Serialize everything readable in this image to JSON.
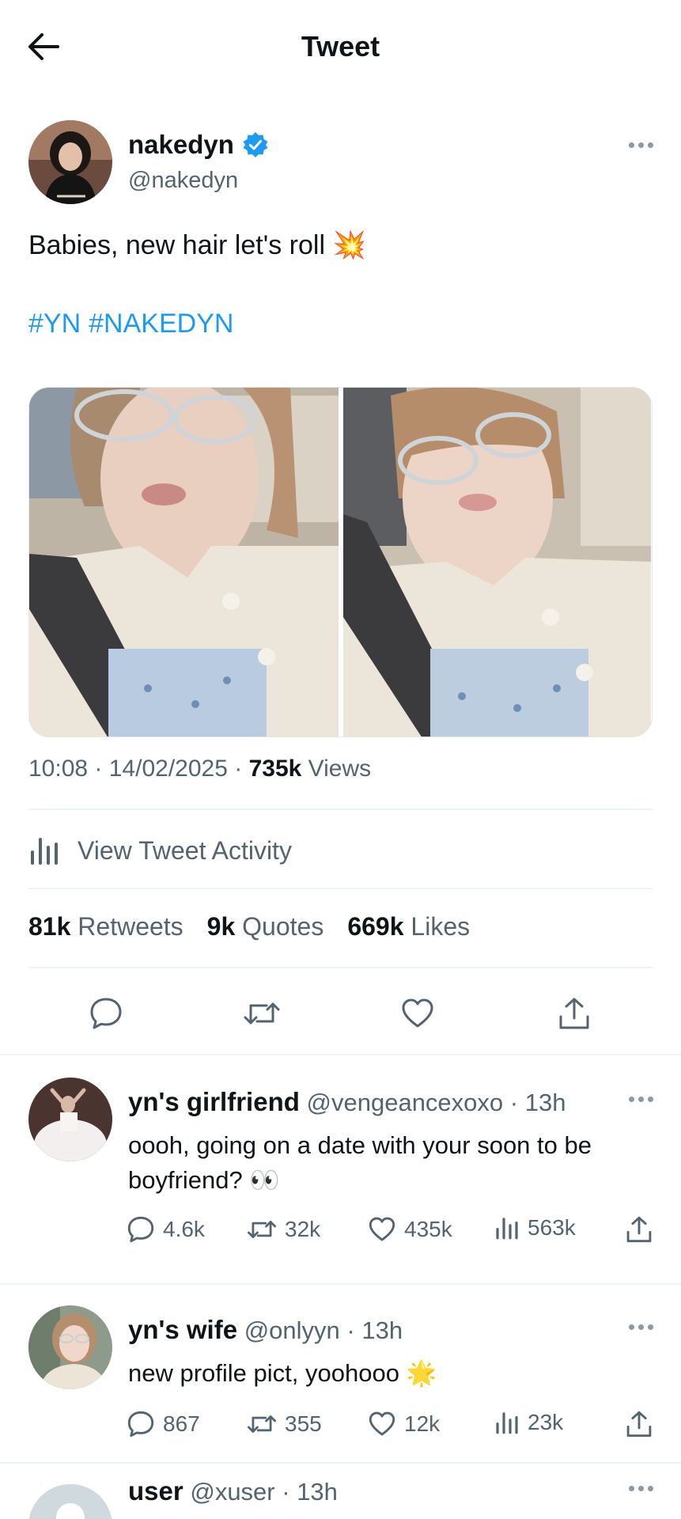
{
  "header": {
    "title": "Tweet",
    "back_icon": "arrow-left-icon"
  },
  "tweet": {
    "author_name": "nakedyn",
    "author_handle": "@nakedyn",
    "verified": true,
    "text": "Babies, new hair let's roll 💥",
    "hashtags": [
      "#YN",
      "#NAKEDYN"
    ],
    "time": "10:08",
    "date": "14/02/2025",
    "views_count": "735k",
    "views_label": "Views",
    "activity_label": "View Tweet Activity",
    "stats": {
      "retweets_count": "81k",
      "retweets_label": "Retweets",
      "quotes_count": "9k",
      "quotes_label": "Quotes",
      "likes_count": "669k",
      "likes_label": "Likes"
    }
  },
  "replies": [
    {
      "name": "yn's girlfriend",
      "handle": "@vengeancexoxo",
      "time": "13h",
      "text": "oooh, going on a date with your soon to be boyfriend? 👀",
      "replies": "4.6k",
      "retweets": "32k",
      "likes": "435k",
      "views": "563k"
    },
    {
      "name": "yn's wife",
      "handle": "@onlyyn",
      "time": "13h",
      "text": "new profile pict, yoohooo 🌟",
      "replies": "867",
      "retweets": "355",
      "likes": "12k",
      "views": "23k"
    },
    {
      "name": "user",
      "handle": "@xuser",
      "time": "13h"
    }
  ],
  "colors": {
    "accent": "#1d9bf0",
    "muted": "#536471",
    "text": "#0f1419",
    "divider": "#eff3f4"
  }
}
